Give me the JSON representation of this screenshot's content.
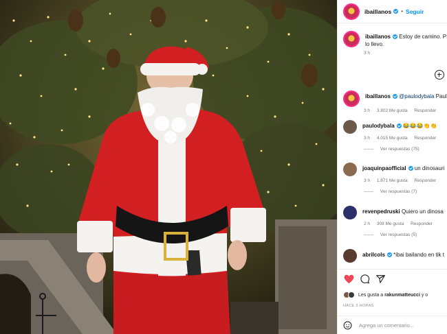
{
  "post": {
    "author": "ibaillanos",
    "follow_label": "Seguir",
    "separator": "•",
    "caption_text": "Estoy de camino. Pí",
    "caption_line2": "lo llevo.",
    "caption_time": "3 h"
  },
  "comments": [
    {
      "user": "ibaillanos",
      "text": "@paulodybala Paulo",
      "mention": "@paulodybala",
      "rest": "Paulo",
      "time": "3 h",
      "likes": "3.802 Me gusta",
      "reply": "Responder",
      "view_replies": ""
    },
    {
      "user": "paulodybala",
      "text": "😂😂😂👏👏",
      "time": "3 h",
      "likes": "4.015 Me gusta",
      "reply": "Responder",
      "view_replies": "Ver respuestas (75)"
    },
    {
      "user": "joaquinpaofficial",
      "text": "un dinosauri",
      "time": "3 h",
      "likes": "1.871 Me gusta",
      "reply": "Responder",
      "view_replies": "Ver respuestas (7)"
    },
    {
      "user": "revenpedruski",
      "text": "Quiero un dinosa",
      "time": "2 h",
      "likes": "308 Me gusta",
      "reply": "Responder",
      "view_replies": "Ver respuestas (5)"
    },
    {
      "user": "abrilcols",
      "text": "*ibai bailando en tik t",
      "time": "3 h",
      "likes": "",
      "reply": "",
      "view_replies": ""
    }
  ],
  "liked_by": {
    "prefix": "Les gusta a",
    "user": "rakunmatteucci",
    "suffix": "y o"
  },
  "timestamp": "HACE 3 HORAS",
  "add_comment_placeholder": "Agrega un comentario...",
  "icons": [
    "heart-icon",
    "comment-icon",
    "share-icon",
    "add-icon",
    "emoji-icon"
  ],
  "colors": {
    "accent": "#0095f6",
    "like": "#ed4956",
    "verified": "#1d9bf0"
  }
}
